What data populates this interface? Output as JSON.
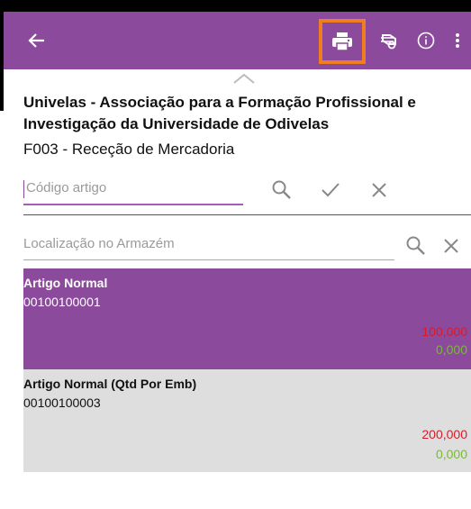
{
  "toolbar": {
    "icons": [
      "back-arrow-icon",
      "print-icon",
      "scan-icon",
      "info-icon",
      "more-vert-icon"
    ],
    "background": "#8b4a9c",
    "highlight": "#ef7d22"
  },
  "header": {
    "company": "Univelas - Associação para a Formação Profissional e Investigação da Universidade de Odivelas",
    "document": "F003 - Receção de Mercadoria"
  },
  "form": {
    "code_placeholder": "Código artigo",
    "location_placeholder": "Localização no Armazém"
  },
  "items": [
    {
      "name": "Artigo Normal",
      "code": "00100100001",
      "qty_required": "100,000",
      "qty_done": "0,000"
    },
    {
      "name": "Artigo Normal (Qtd Por Emb)",
      "code": "00100100003",
      "qty_required": "200,000",
      "qty_done": "0,000"
    }
  ],
  "colors": {
    "accent": "#8b4a9c",
    "required": "#d81b2b",
    "done": "#7ab83a"
  }
}
